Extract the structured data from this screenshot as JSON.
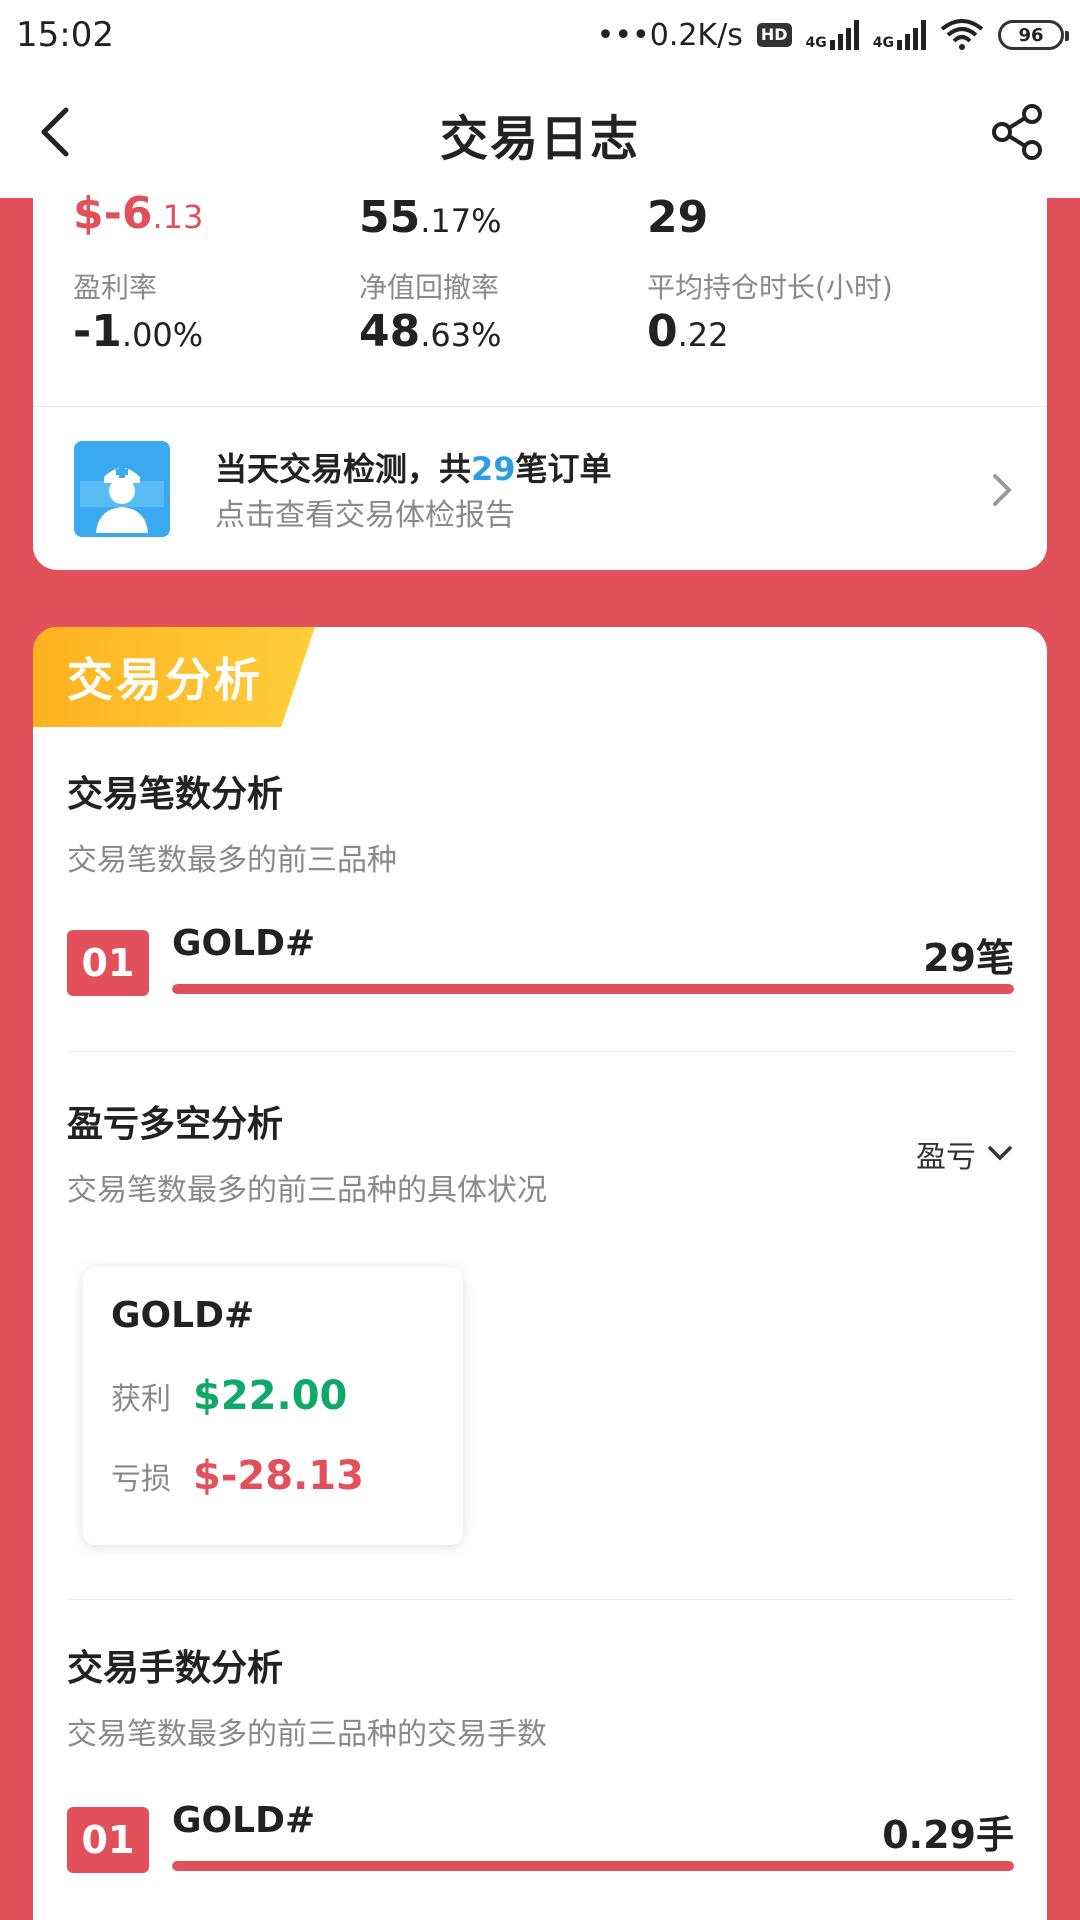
{
  "status": {
    "time": "15:02",
    "net_speed": "•••0.2K/s",
    "hd": "HD",
    "net1": "4G",
    "net2": "4G",
    "battery": "96"
  },
  "nav": {
    "title": "交易日志"
  },
  "summary": {
    "profit": {
      "main": "$-6",
      "dec": ".13"
    },
    "win_rate": {
      "main": "55",
      "dec": ".17%"
    },
    "count": {
      "main": "29"
    },
    "profit_rate": {
      "label": "盈利率",
      "main": "-1",
      "dec": ".00%"
    },
    "drawdown": {
      "label": "净值回撤率",
      "main": "48",
      "dec": ".63%"
    },
    "hold_time": {
      "label": "平均持仓时长(小时)",
      "main": "0",
      "dec": ".22"
    }
  },
  "check": {
    "title_pre": "当天交易检测，共",
    "title_num": "29",
    "title_post": "笔订单",
    "subtitle": "点击查看交易体检报告"
  },
  "analysis": {
    "ribbon": "交易分析",
    "count_section": {
      "title": "交易笔数分析",
      "subtitle": "交易笔数最多的前三品种",
      "items": [
        {
          "rank": "01",
          "symbol": "GOLD#",
          "value": "29笔",
          "fill": 1.0
        }
      ]
    },
    "pl_section": {
      "title": "盈亏多空分析",
      "subtitle": "交易笔数最多的前三品种的具体状况",
      "dropdown": "盈亏",
      "card": {
        "symbol": "GOLD#",
        "profit_label": "获利",
        "profit_value": "$22.00",
        "loss_label": "亏损",
        "loss_value": "$-28.13"
      }
    },
    "lots_section": {
      "title": "交易手数分析",
      "subtitle": "交易笔数最多的前三品种的交易手数",
      "items": [
        {
          "rank": "01",
          "symbol": "GOLD#",
          "value": "0.29手",
          "fill": 1.0
        }
      ]
    }
  },
  "colors": {
    "accent": "#e2515b",
    "gold": "#ffb21f",
    "green": "#10a86a",
    "blue": "#2f9de6"
  }
}
